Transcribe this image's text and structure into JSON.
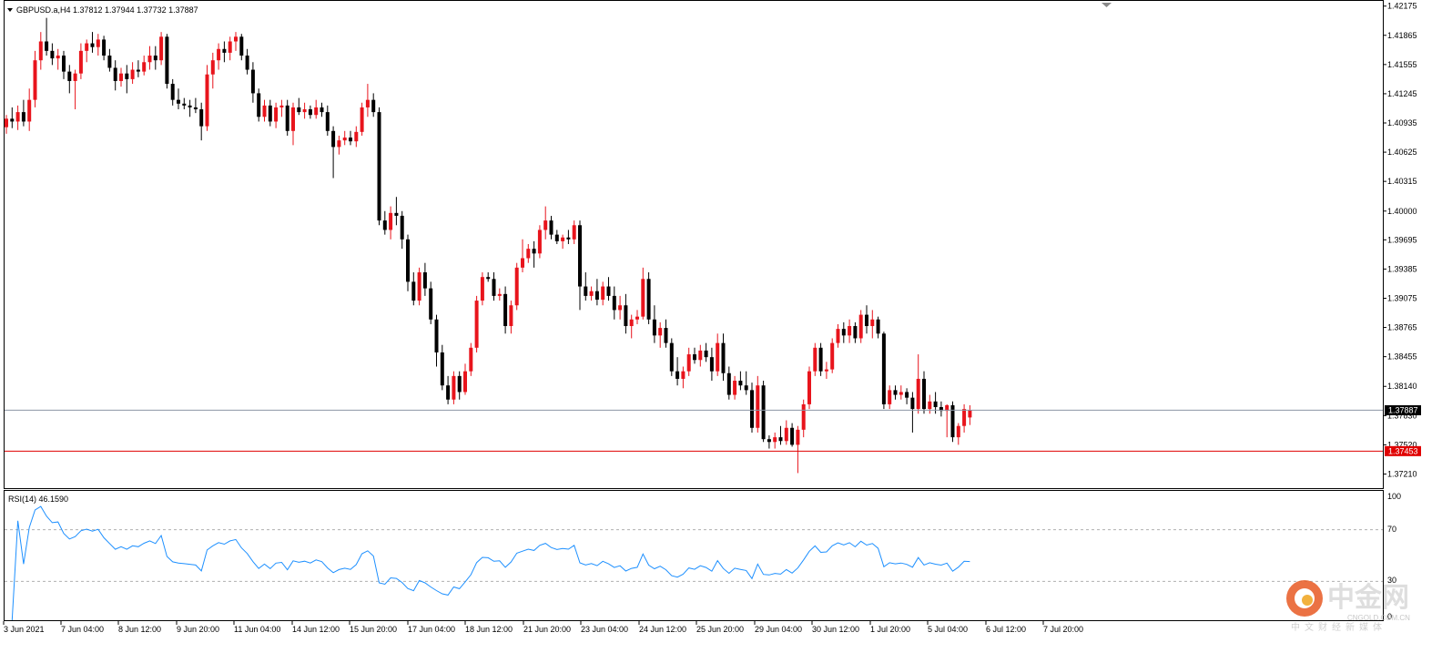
{
  "header": {
    "title": "GBPUSD.a,H4  1.37812 1.37944 1.37732 1.37887"
  },
  "rsi": {
    "label": "RSI(14) 46.1590",
    "axis_labels": [
      "100",
      "70",
      "30",
      "0"
    ],
    "levels": [
      70,
      30
    ],
    "ylim": [
      0,
      100
    ]
  },
  "price_axis": {
    "ticks": [
      "1.42175",
      "1.41865",
      "1.41555",
      "1.41245",
      "1.40935",
      "1.40625",
      "1.40315",
      "1.40000",
      "1.39695",
      "1.39385",
      "1.39075",
      "1.38765",
      "1.38455",
      "1.38140",
      "1.37830",
      "1.37520",
      "1.37210"
    ]
  },
  "lines": {
    "current_price": "1.37887",
    "support_price": "1.37453",
    "current_color": "#8c96a6",
    "support_color": "#e00000"
  },
  "time_axis": {
    "labels": [
      "3 Jun 2021",
      "7 Jun 04:00",
      "8 Jun 12:00",
      "9 Jun 20:00",
      "11 Jun 04:00",
      "14 Jun 12:00",
      "15 Jun 20:00",
      "17 Jun 04:00",
      "18 Jun 12:00",
      "21 Jun 20:00",
      "23 Jun 04:00",
      "24 Jun 12:00",
      "25 Jun 20:00",
      "29 Jun 04:00",
      "30 Jun 12:00",
      "1 Jul 20:00",
      "5 Jul 04:00",
      "6 Jul 12:00",
      "7 Jul 20:00"
    ]
  },
  "colors": {
    "bull": "#e8141c",
    "bear": "#000000",
    "last_bull": "#20c020",
    "rsi_line": "#1e90ff",
    "grid": "#b0b0b0"
  },
  "watermark": {
    "cn": "中金网",
    "en": "CNGOLD.COM.CN",
    "tag": "中文财经新媒体"
  },
  "chart_data": {
    "type": "candlestick",
    "title": "GBPUSD.a,H4",
    "ylim": [
      1.3706,
      1.4223
    ],
    "candles": [
      [
        1.4089,
        1.4102,
        1.4082,
        1.4098
      ],
      [
        1.4098,
        1.411,
        1.4088,
        1.4095
      ],
      [
        1.4095,
        1.4112,
        1.4086,
        1.4105
      ],
      [
        1.4105,
        1.4118,
        1.409,
        1.4095
      ],
      [
        1.4095,
        1.413,
        1.4085,
        1.4118
      ],
      [
        1.4118,
        1.417,
        1.411,
        1.416
      ],
      [
        1.416,
        1.419,
        1.415,
        1.418
      ],
      [
        1.418,
        1.4205,
        1.4165,
        1.417
      ],
      [
        1.417,
        1.4178,
        1.4155,
        1.4162
      ],
      [
        1.4162,
        1.4172,
        1.415,
        1.4165
      ],
      [
        1.4165,
        1.417,
        1.414,
        1.4148
      ],
      [
        1.4148,
        1.4155,
        1.4125,
        1.4138
      ],
      [
        1.4138,
        1.415,
        1.4108,
        1.4146
      ],
      [
        1.4146,
        1.4178,
        1.414,
        1.417
      ],
      [
        1.417,
        1.4182,
        1.4158,
        1.4178
      ],
      [
        1.4178,
        1.419,
        1.4168,
        1.4174
      ],
      [
        1.4174,
        1.4188,
        1.4165,
        1.4182
      ],
      [
        1.4182,
        1.4186,
        1.416,
        1.4165
      ],
      [
        1.4165,
        1.4172,
        1.4148,
        1.4152
      ],
      [
        1.4152,
        1.416,
        1.4128,
        1.4138
      ],
      [
        1.4138,
        1.4152,
        1.4132,
        1.4146
      ],
      [
        1.4146,
        1.4155,
        1.4125,
        1.414
      ],
      [
        1.414,
        1.4158,
        1.4135,
        1.415
      ],
      [
        1.415,
        1.416,
        1.4142,
        1.4148
      ],
      [
        1.4148,
        1.4165,
        1.4144,
        1.4158
      ],
      [
        1.4158,
        1.4175,
        1.415,
        1.4165
      ],
      [
        1.4165,
        1.4175,
        1.415,
        1.416
      ],
      [
        1.416,
        1.419,
        1.4155,
        1.4185
      ],
      [
        1.4185,
        1.4188,
        1.413,
        1.4135
      ],
      [
        1.4135,
        1.414,
        1.4112,
        1.4118
      ],
      [
        1.4118,
        1.413,
        1.4108,
        1.4114
      ],
      [
        1.4114,
        1.412,
        1.4108,
        1.4112
      ],
      [
        1.4112,
        1.4118,
        1.41,
        1.411
      ],
      [
        1.411,
        1.412,
        1.4104,
        1.4108
      ],
      [
        1.4108,
        1.4115,
        1.4075,
        1.409
      ],
      [
        1.409,
        1.4155,
        1.4085,
        1.4145
      ],
      [
        1.4145,
        1.4168,
        1.413,
        1.416
      ],
      [
        1.416,
        1.4178,
        1.415,
        1.4172
      ],
      [
        1.4172,
        1.418,
        1.4158,
        1.4168
      ],
      [
        1.4168,
        1.4185,
        1.416,
        1.418
      ],
      [
        1.418,
        1.419,
        1.417,
        1.4185
      ],
      [
        1.4185,
        1.4188,
        1.416,
        1.4165
      ],
      [
        1.4165,
        1.4172,
        1.4145,
        1.415
      ],
      [
        1.415,
        1.4158,
        1.4115,
        1.4125
      ],
      [
        1.4125,
        1.413,
        1.4095,
        1.41
      ],
      [
        1.41,
        1.4118,
        1.4095,
        1.4112
      ],
      [
        1.4112,
        1.4118,
        1.409,
        1.4095
      ],
      [
        1.4095,
        1.4115,
        1.4088,
        1.411
      ],
      [
        1.411,
        1.4118,
        1.41,
        1.4112
      ],
      [
        1.4112,
        1.4118,
        1.408,
        1.4085
      ],
      [
        1.4085,
        1.4115,
        1.407,
        1.411
      ],
      [
        1.411,
        1.412,
        1.4102,
        1.4105
      ],
      [
        1.4105,
        1.4115,
        1.4098,
        1.4108
      ],
      [
        1.4108,
        1.4112,
        1.4098,
        1.4102
      ],
      [
        1.4102,
        1.4118,
        1.4098,
        1.411
      ],
      [
        1.411,
        1.4115,
        1.41,
        1.4105
      ],
      [
        1.4105,
        1.4112,
        1.408,
        1.4085
      ],
      [
        1.4085,
        1.409,
        1.4035,
        1.4068
      ],
      [
        1.4068,
        1.408,
        1.406,
        1.4075
      ],
      [
        1.4075,
        1.4085,
        1.407,
        1.4078
      ],
      [
        1.4078,
        1.4085,
        1.407,
        1.4074
      ],
      [
        1.4074,
        1.409,
        1.4068,
        1.4084
      ],
      [
        1.4084,
        1.4115,
        1.408,
        1.411
      ],
      [
        1.411,
        1.4135,
        1.41,
        1.4118
      ],
      [
        1.4118,
        1.4125,
        1.41,
        1.4105
      ],
      [
        1.4105,
        1.411,
        1.3985,
        1.399
      ],
      [
        1.399,
        1.4,
        1.3975,
        1.398
      ],
      [
        1.398,
        1.4005,
        1.397,
        1.3998
      ],
      [
        1.3998,
        1.4015,
        1.3985,
        1.3995
      ],
      [
        1.3995,
        1.4,
        1.396,
        1.397
      ],
      [
        1.397,
        1.3975,
        1.3915,
        1.3925
      ],
      [
        1.3925,
        1.3935,
        1.39,
        1.3905
      ],
      [
        1.3905,
        1.394,
        1.39,
        1.3935
      ],
      [
        1.3935,
        1.3945,
        1.391,
        1.3918
      ],
      [
        1.3918,
        1.3925,
        1.388,
        1.3885
      ],
      [
        1.3885,
        1.389,
        1.3835,
        1.385
      ],
      [
        1.385,
        1.3858,
        1.381,
        1.3815
      ],
      [
        1.3815,
        1.3825,
        1.3795,
        1.38
      ],
      [
        1.38,
        1.383,
        1.3795,
        1.3825
      ],
      [
        1.3825,
        1.383,
        1.38,
        1.3808
      ],
      [
        1.3808,
        1.3838,
        1.3805,
        1.383
      ],
      [
        1.383,
        1.386,
        1.3825,
        1.3855
      ],
      [
        1.3855,
        1.391,
        1.385,
        1.3905
      ],
      [
        1.3905,
        1.3935,
        1.39,
        1.393
      ],
      [
        1.393,
        1.3935,
        1.3925,
        1.3928
      ],
      [
        1.3928,
        1.3935,
        1.3905,
        1.391
      ],
      [
        1.391,
        1.3918,
        1.3905,
        1.3912
      ],
      [
        1.3912,
        1.392,
        1.387,
        1.3878
      ],
      [
        1.3878,
        1.3905,
        1.387,
        1.39
      ],
      [
        1.39,
        1.3945,
        1.3895,
        1.394
      ],
      [
        1.394,
        1.397,
        1.3935,
        1.395
      ],
      [
        1.395,
        1.3965,
        1.3945,
        1.396
      ],
      [
        1.396,
        1.3968,
        1.394,
        1.3955
      ],
      [
        1.3955,
        1.3985,
        1.395,
        1.398
      ],
      [
        1.398,
        1.4005,
        1.397,
        1.399
      ],
      [
        1.399,
        1.3995,
        1.397,
        1.3975
      ],
      [
        1.3975,
        1.398,
        1.3965,
        1.3968
      ],
      [
        1.3968,
        1.3975,
        1.396,
        1.3972
      ],
      [
        1.3972,
        1.398,
        1.3965,
        1.397
      ],
      [
        1.397,
        1.399,
        1.3965,
        1.3985
      ],
      [
        1.3985,
        1.399,
        1.3895,
        1.392
      ],
      [
        1.392,
        1.3935,
        1.3905,
        1.391
      ],
      [
        1.391,
        1.392,
        1.3905,
        1.3915
      ],
      [
        1.3915,
        1.3928,
        1.39,
        1.3906
      ],
      [
        1.3906,
        1.3925,
        1.39,
        1.392
      ],
      [
        1.392,
        1.393,
        1.3905,
        1.391
      ],
      [
        1.391,
        1.392,
        1.3885,
        1.3895
      ],
      [
        1.3895,
        1.391,
        1.3885,
        1.39
      ],
      [
        1.39,
        1.3912,
        1.387,
        1.3878
      ],
      [
        1.3878,
        1.389,
        1.3865,
        1.3885
      ],
      [
        1.3885,
        1.3895,
        1.388,
        1.3888
      ],
      [
        1.3888,
        1.394,
        1.3885,
        1.3928
      ],
      [
        1.3928,
        1.3935,
        1.388,
        1.3885
      ],
      [
        1.3885,
        1.39,
        1.386,
        1.3868
      ],
      [
        1.3868,
        1.3882,
        1.3855,
        1.3876
      ],
      [
        1.3876,
        1.3885,
        1.3855,
        1.386
      ],
      [
        1.386,
        1.3865,
        1.3825,
        1.383
      ],
      [
        1.383,
        1.3845,
        1.3815,
        1.3822
      ],
      [
        1.3822,
        1.3835,
        1.3812,
        1.383
      ],
      [
        1.383,
        1.3855,
        1.3825,
        1.3848
      ],
      [
        1.3848,
        1.3855,
        1.3838,
        1.3842
      ],
      [
        1.3842,
        1.3858,
        1.3835,
        1.3852
      ],
      [
        1.3852,
        1.386,
        1.384,
        1.3845
      ],
      [
        1.3845,
        1.3855,
        1.382,
        1.383
      ],
      [
        1.383,
        1.387,
        1.3825,
        1.386
      ],
      [
        1.386,
        1.387,
        1.382,
        1.3828
      ],
      [
        1.3828,
        1.3835,
        1.38,
        1.3805
      ],
      [
        1.3805,
        1.3825,
        1.38,
        1.382
      ],
      [
        1.382,
        1.383,
        1.381,
        1.3815
      ],
      [
        1.3815,
        1.383,
        1.3805,
        1.381
      ],
      [
        1.381,
        1.3818,
        1.3765,
        1.377
      ],
      [
        1.377,
        1.3825,
        1.3765,
        1.3815
      ],
      [
        1.3815,
        1.382,
        1.3755,
        1.3758
      ],
      [
        1.3758,
        1.3762,
        1.3748,
        1.3755
      ],
      [
        1.3755,
        1.3765,
        1.3748,
        1.376
      ],
      [
        1.376,
        1.3772,
        1.3752,
        1.3756
      ],
      [
        1.3756,
        1.3778,
        1.3752,
        1.377
      ],
      [
        1.377,
        1.3775,
        1.375,
        1.3752
      ],
      [
        1.3752,
        1.3772,
        1.3722,
        1.3768
      ],
      [
        1.3768,
        1.38,
        1.376,
        1.3795
      ],
      [
        1.3795,
        1.3835,
        1.379,
        1.383
      ],
      [
        1.383,
        1.386,
        1.3825,
        1.3855
      ],
      [
        1.3855,
        1.386,
        1.3825,
        1.383
      ],
      [
        1.383,
        1.384,
        1.3822,
        1.3832
      ],
      [
        1.3832,
        1.3865,
        1.3828,
        1.386
      ],
      [
        1.386,
        1.388,
        1.3855,
        1.3875
      ],
      [
        1.3875,
        1.3882,
        1.386,
        1.3868
      ],
      [
        1.3868,
        1.3885,
        1.386,
        1.3878
      ],
      [
        1.3878,
        1.3882,
        1.386,
        1.3865
      ],
      [
        1.3865,
        1.3895,
        1.386,
        1.389
      ],
      [
        1.389,
        1.39,
        1.387,
        1.3878
      ],
      [
        1.3878,
        1.3895,
        1.3865,
        1.3885
      ],
      [
        1.3885,
        1.3888,
        1.3865,
        1.387
      ],
      [
        1.387,
        1.3872,
        1.379,
        1.3795
      ],
      [
        1.3795,
        1.3815,
        1.379,
        1.381
      ],
      [
        1.381,
        1.3815,
        1.38,
        1.3805
      ],
      [
        1.3805,
        1.3815,
        1.38,
        1.3808
      ],
      [
        1.3808,
        1.3812,
        1.3795,
        1.3802
      ],
      [
        1.3802,
        1.3808,
        1.3765,
        1.379
      ],
      [
        1.379,
        1.3848,
        1.3785,
        1.3822
      ],
      [
        1.3822,
        1.383,
        1.3785,
        1.379
      ],
      [
        1.379,
        1.3805,
        1.3785,
        1.3798
      ],
      [
        1.3798,
        1.3808,
        1.3785,
        1.3792
      ],
      [
        1.3792,
        1.3798,
        1.3782,
        1.3788
      ],
      [
        1.3788,
        1.3795,
        1.376,
        1.3794
      ],
      [
        1.3794,
        1.3798,
        1.3755,
        1.376
      ],
      [
        1.376,
        1.3775,
        1.3752,
        1.3772
      ],
      [
        1.3772,
        1.3795,
        1.3765,
        1.379
      ],
      [
        1.3781,
        1.3794,
        1.3773,
        1.3789
      ]
    ]
  }
}
